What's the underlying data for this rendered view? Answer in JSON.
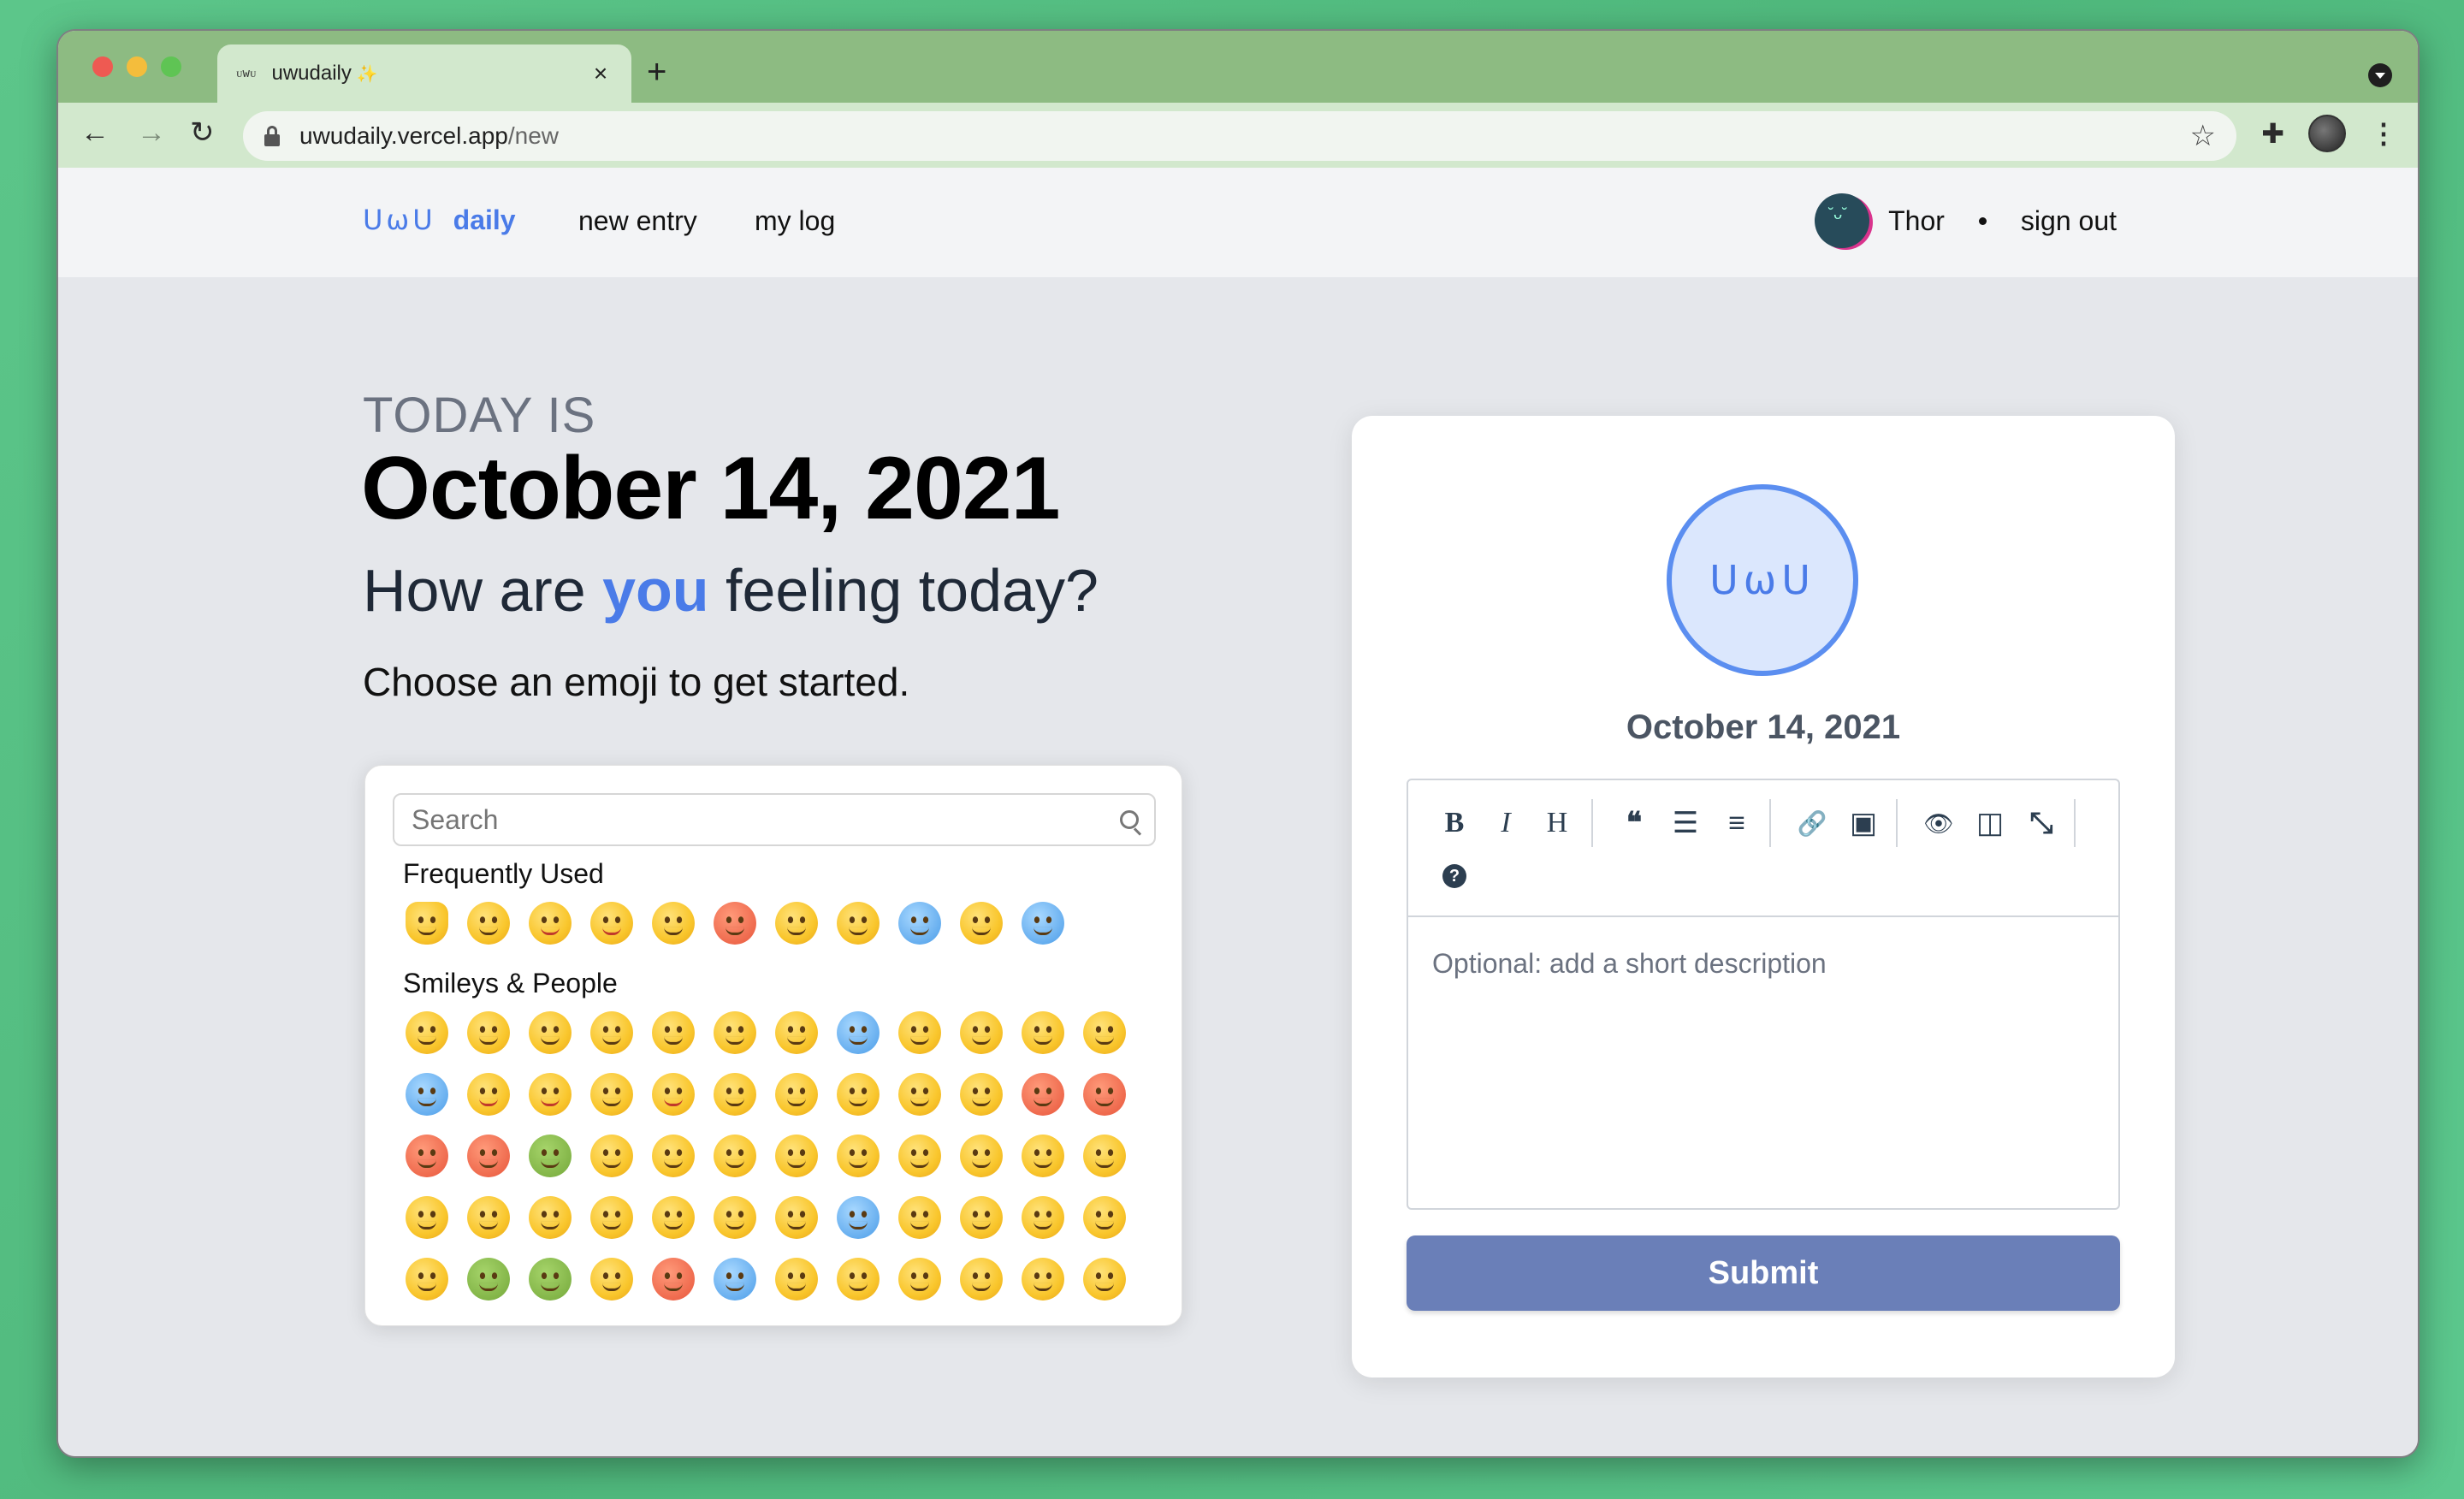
{
  "browser": {
    "tab_title": "uwudaily",
    "tab_sparkle": "✨",
    "tab_favicon": "ᴜwᴜ",
    "new_tab": "+",
    "url_host": "uwudaily.vercel.app",
    "url_path": "/new"
  },
  "nav": {
    "brand_logo": "ᑌωᑌ",
    "brand_name": "daily",
    "links": [
      "new entry",
      "my log"
    ],
    "user_name": "Thor",
    "sign_out": "sign out"
  },
  "hero": {
    "today_label": "TODAY IS",
    "date": "October 14, 2021",
    "question_pre": "How are ",
    "question_you": "you",
    "question_post": " feeling today?",
    "instruction": "Choose an emoji to get started."
  },
  "picker": {
    "search_placeholder": "Search",
    "sections": [
      "Frequently Used",
      "Smileys & People"
    ]
  },
  "card": {
    "avatar": "ᑌωᑌ",
    "date": "October 14, 2021",
    "editor_placeholder": "Optional: add a short description",
    "toolbar": [
      "B",
      "I",
      "H",
      "❝",
      "☰",
      "≡",
      "🔗",
      "▣",
      "👁",
      "◫",
      "⤡",
      "?"
    ],
    "submit": "Submit"
  },
  "colors": {
    "accent": "#4a7be8",
    "submit": "#6a7fb8",
    "nav_bg": "#f3f4f6",
    "page_bg": "#e5e7eb"
  }
}
